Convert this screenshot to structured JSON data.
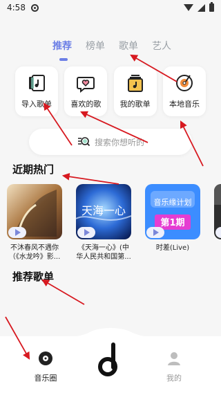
{
  "status": {
    "time": "4:58"
  },
  "tabs": [
    {
      "label": "推荐",
      "active": true
    },
    {
      "label": "榜单",
      "active": false
    },
    {
      "label": "歌单",
      "active": false
    },
    {
      "label": "艺人",
      "active": false
    }
  ],
  "quick": [
    {
      "label": "导入歌单",
      "icon": "import-playlist-icon"
    },
    {
      "label": "喜欢的歌",
      "icon": "liked-songs-icon"
    },
    {
      "label": "我的歌单",
      "icon": "my-playlist-icon"
    },
    {
      "label": "本地音乐",
      "icon": "local-music-icon"
    }
  ],
  "search": {
    "placeholder": "搜索你想听的"
  },
  "sections": {
    "hot": "近期热门",
    "recommend": "推荐歌单"
  },
  "hot_items": [
    {
      "title": "不沐春风不遇你",
      "subtitle": "（《水龙吟》影..."
    },
    {
      "title": "《天海一心》(中",
      "subtitle": "华人民共和国第..."
    },
    {
      "title": "时差(Live)",
      "subtitle": ""
    }
  ],
  "cover_texts": {
    "cover2_overlay": "天海一心",
    "cover3_top": "音乐缘计划",
    "cover3_badge": "第1期"
  },
  "bottom_nav": {
    "left": "音乐圈",
    "right": "我的"
  },
  "colors": {
    "accent": "#6c7fe6",
    "arrow": "#d71920"
  }
}
